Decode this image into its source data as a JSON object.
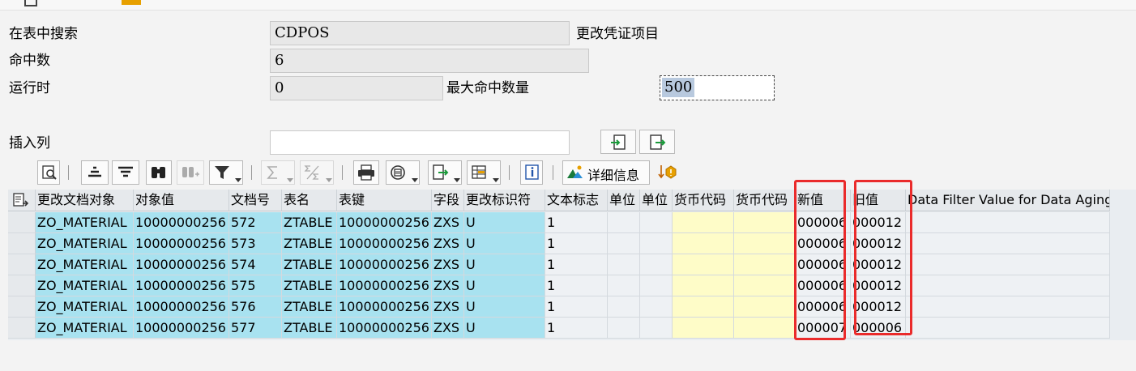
{
  "search": {
    "label_table": "在表中搜索",
    "table_value": "CDPOS",
    "table_desc": "更改凭证项目",
    "label_hits": "命中数",
    "hits_value": "6",
    "label_runtime": "运行时",
    "runtime_value": "0",
    "label_max_hits": "最大命中数量",
    "max_hits_value": "500",
    "label_insert_col": "插入列",
    "insert_col_value": ""
  },
  "toolbar": {
    "detail_label": "详细信息"
  },
  "icons": [
    "details-icon",
    "align-center-icon",
    "align-left-icon",
    "find-icon",
    "find-next-icon",
    "filter-icon",
    "sum-icon",
    "subtotal-icon",
    "print-icon",
    "views-icon",
    "export-icon",
    "layout-icon",
    "info-icon",
    "detail-info-icon",
    "data-aging-icon",
    "select-all-icon",
    "insert-column-icon",
    "move-column-icon"
  ],
  "table": {
    "columns": [
      "更改文档对象",
      "对象值",
      "文档号",
      "表名",
      "表键",
      "字段",
      "更改标识符",
      "文本标志",
      "单位",
      "单位",
      "货币代码",
      "货币代码",
      "新值",
      "旧值",
      "Data Filter Value for Data Aging"
    ],
    "rows": [
      [
        "ZO_MATERIAL",
        "10000000256",
        "572",
        "ZTABLE",
        "10000000256",
        "ZXS",
        "U",
        "1",
        "",
        "",
        "",
        "",
        "000006",
        "000012",
        ""
      ],
      [
        "ZO_MATERIAL",
        "10000000256",
        "573",
        "ZTABLE",
        "10000000256",
        "ZXS",
        "U",
        "1",
        "",
        "",
        "",
        "",
        "000006",
        "000012",
        ""
      ],
      [
        "ZO_MATERIAL",
        "10000000256",
        "574",
        "ZTABLE",
        "10000000256",
        "ZXS",
        "U",
        "1",
        "",
        "",
        "",
        "",
        "000006",
        "000012",
        ""
      ],
      [
        "ZO_MATERIAL",
        "10000000256",
        "575",
        "ZTABLE",
        "10000000256",
        "ZXS",
        "U",
        "1",
        "",
        "",
        "",
        "",
        "000006",
        "000012",
        ""
      ],
      [
        "ZO_MATERIAL",
        "10000000256",
        "576",
        "ZTABLE",
        "10000000256",
        "ZXS",
        "U",
        "1",
        "",
        "",
        "",
        "",
        "000006",
        "000012",
        ""
      ],
      [
        "ZO_MATERIAL",
        "10000000256",
        "577",
        "ZTABLE",
        "10000000256",
        "ZXS",
        "U",
        "1",
        "",
        "",
        "",
        "",
        "000007",
        "000006",
        ""
      ]
    ]
  },
  "colors": {
    "key_column": "#a8e2f0",
    "currency_column": "#fefcc8",
    "highlight_box": "#ea2b2b"
  }
}
